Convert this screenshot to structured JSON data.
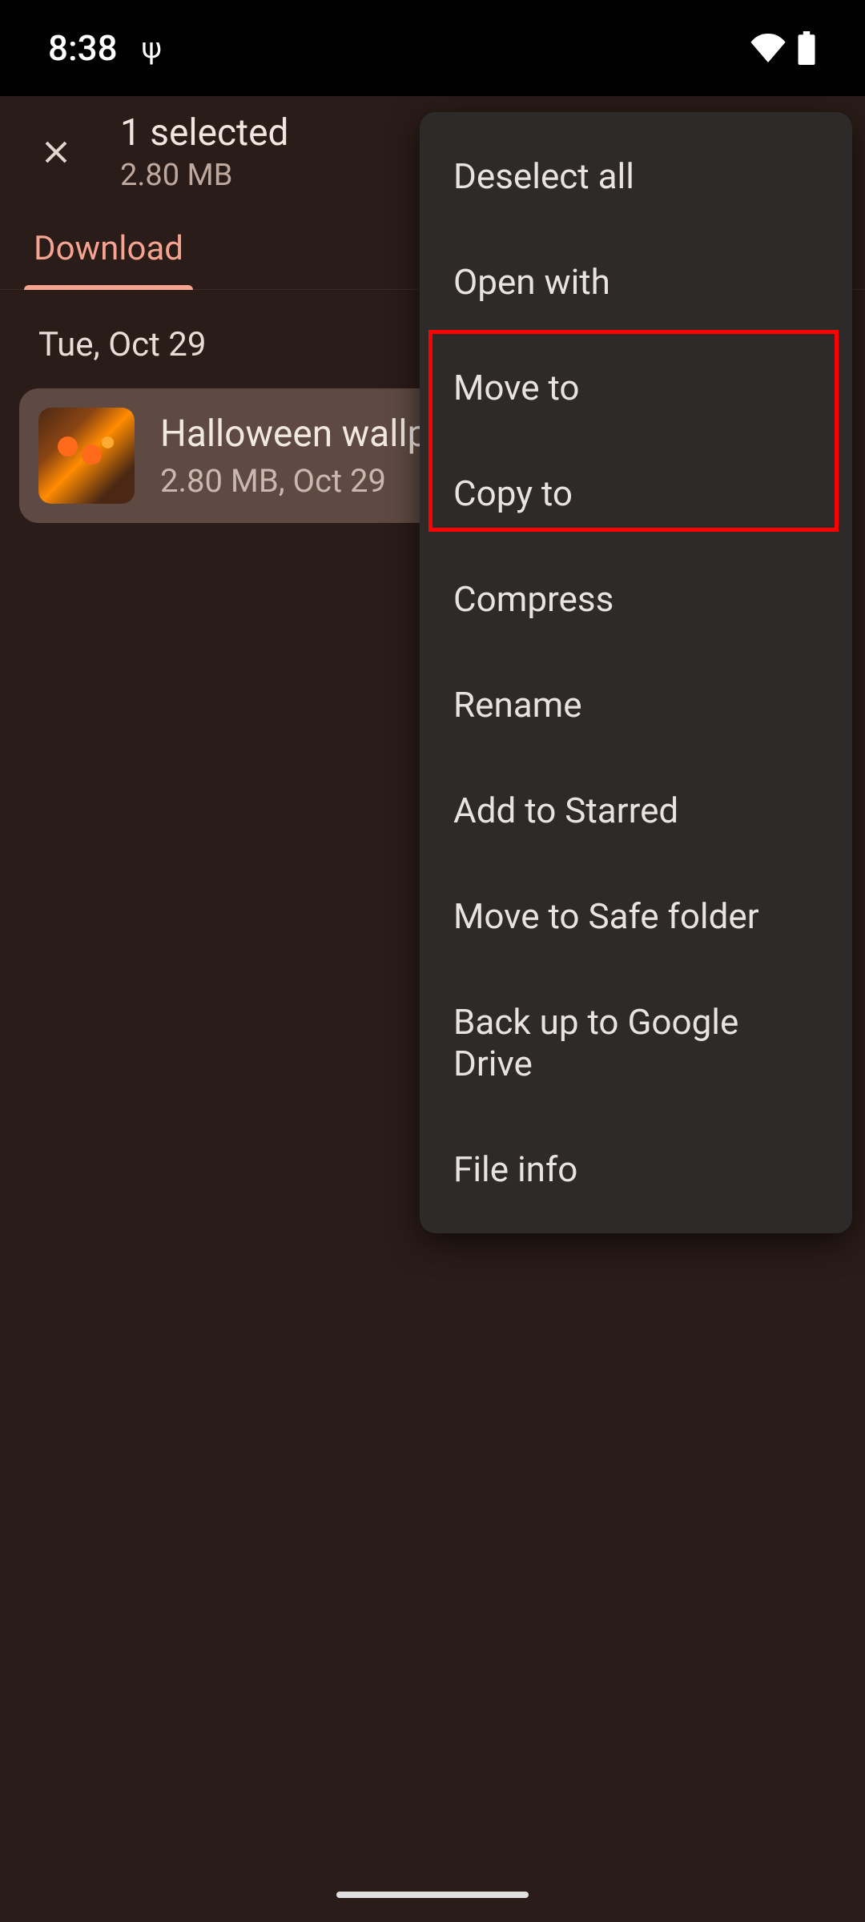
{
  "status": {
    "time": "8:38",
    "usb_glyph": "ψ"
  },
  "header": {
    "selection_count": "1 selected",
    "selection_size": "2.80 MB"
  },
  "tabs": {
    "active": "Download"
  },
  "files": {
    "date_header": "Tue, Oct 29",
    "item": {
      "name": "Halloween wallpa",
      "meta": "2.80 MB, Oct 29"
    }
  },
  "menu": {
    "items": [
      "Deselect all",
      "Open with",
      "Move to",
      "Copy to",
      "Compress",
      "Rename",
      "Add to Starred",
      "Move to Safe folder",
      "Back up to Google Drive",
      "File info"
    ]
  }
}
